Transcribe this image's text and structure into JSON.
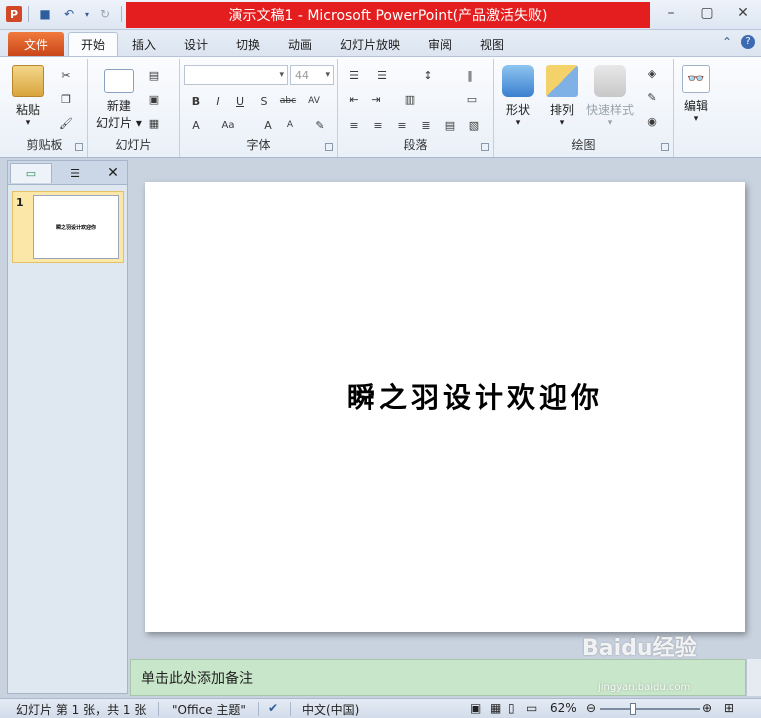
{
  "window": {
    "title": "演示文稿1 - Microsoft PowerPoint(产品激活失败)",
    "app_icon": "powerpoint-icon"
  },
  "tabs": [
    {
      "label": "文件"
    },
    {
      "label": "开始"
    },
    {
      "label": "插入"
    },
    {
      "label": "设计"
    },
    {
      "label": "切换"
    },
    {
      "label": "动画"
    },
    {
      "label": "幻灯片放映"
    },
    {
      "label": "审阅"
    },
    {
      "label": "视图"
    }
  ],
  "ribbon": {
    "clipboard": {
      "paste": "粘贴",
      "group": "剪贴板"
    },
    "slides": {
      "new_line1": "新建",
      "new_line2": "幻灯片 ▾",
      "group": "幻灯片"
    },
    "font": {
      "size": "44",
      "group": "字体"
    },
    "paragraph": {
      "group": "段落"
    },
    "drawing": {
      "shapes": "形状",
      "arrange": "排列",
      "quick_styles": "快速样式",
      "group": "绘图"
    },
    "editing": {
      "edit": "编辑"
    }
  },
  "slide_panel": {
    "thumb_number": "1",
    "thumb_text": "瞬之羽设计欢迎你"
  },
  "slide": {
    "text": "瞬之羽设计欢迎你"
  },
  "notes": {
    "placeholder": "单击此处添加备注"
  },
  "status": {
    "slide_info": "幻灯片 第 1 张，共 1 张",
    "theme": "\"Office 主题\"",
    "language": "中文(中国)",
    "zoom": "62%"
  },
  "watermark": {
    "brand": "Baidu经验",
    "url": "jingyan.baidu.com"
  }
}
